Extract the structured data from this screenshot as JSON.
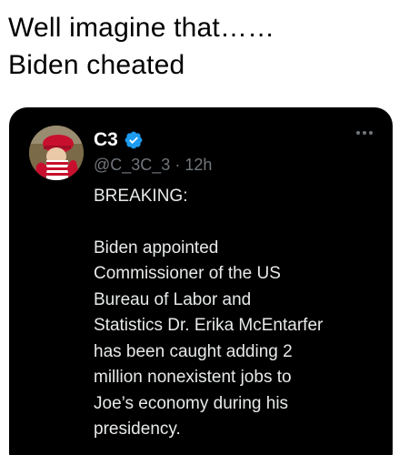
{
  "caption": {
    "line1": "Well imagine that……",
    "line2": "Biden cheated"
  },
  "tweet": {
    "display_name": "C3",
    "verified_icon": "verified-badge-icon",
    "handle": "@C_3C_3",
    "separator": "·",
    "time": "12h",
    "more_icon": "more-options-icon",
    "text_lines_1": [
      "BREAKING:"
    ],
    "text_lines_2": [
      "Biden appointed",
      "Commissioner of the US",
      "Bureau of Labor and",
      "Statistics Dr. Erika McEntarfer",
      "has been caught adding 2",
      "million nonexistent jobs to",
      "Joe’s economy during his",
      "presidency."
    ]
  },
  "colors": {
    "card_bg": "#000000",
    "text_primary": "#e7e9ea",
    "text_secondary": "#71767b",
    "verified_blue": "#1d9bf0"
  }
}
